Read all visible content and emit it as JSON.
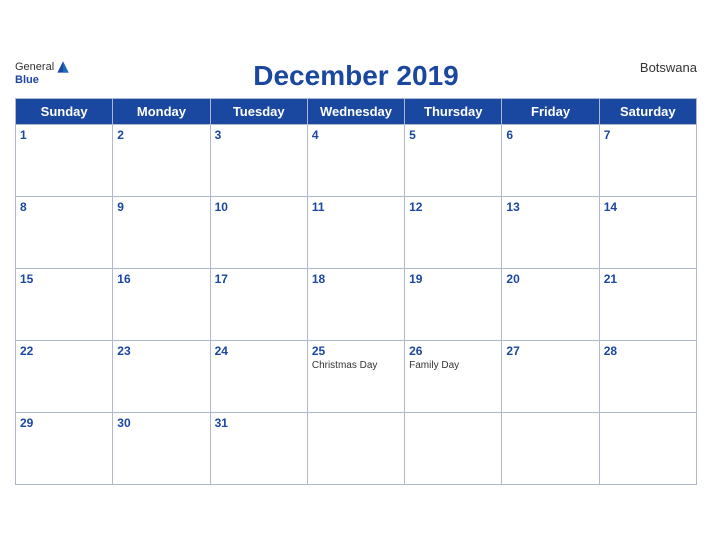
{
  "header": {
    "logo_general": "General",
    "logo_blue": "Blue",
    "title": "December 2019",
    "country": "Botswana"
  },
  "days_of_week": [
    "Sunday",
    "Monday",
    "Tuesday",
    "Wednesday",
    "Thursday",
    "Friday",
    "Saturday"
  ],
  "weeks": [
    [
      {
        "day": "1",
        "holiday": ""
      },
      {
        "day": "2",
        "holiday": ""
      },
      {
        "day": "3",
        "holiday": ""
      },
      {
        "day": "4",
        "holiday": ""
      },
      {
        "day": "5",
        "holiday": ""
      },
      {
        "day": "6",
        "holiday": ""
      },
      {
        "day": "7",
        "holiday": ""
      }
    ],
    [
      {
        "day": "8",
        "holiday": ""
      },
      {
        "day": "9",
        "holiday": ""
      },
      {
        "day": "10",
        "holiday": ""
      },
      {
        "day": "11",
        "holiday": ""
      },
      {
        "day": "12",
        "holiday": ""
      },
      {
        "day": "13",
        "holiday": ""
      },
      {
        "day": "14",
        "holiday": ""
      }
    ],
    [
      {
        "day": "15",
        "holiday": ""
      },
      {
        "day": "16",
        "holiday": ""
      },
      {
        "day": "17",
        "holiday": ""
      },
      {
        "day": "18",
        "holiday": ""
      },
      {
        "day": "19",
        "holiday": ""
      },
      {
        "day": "20",
        "holiday": ""
      },
      {
        "day": "21",
        "holiday": ""
      }
    ],
    [
      {
        "day": "22",
        "holiday": ""
      },
      {
        "day": "23",
        "holiday": ""
      },
      {
        "day": "24",
        "holiday": ""
      },
      {
        "day": "25",
        "holiday": "Christmas Day"
      },
      {
        "day": "26",
        "holiday": "Family Day"
      },
      {
        "day": "27",
        "holiday": ""
      },
      {
        "day": "28",
        "holiday": ""
      }
    ],
    [
      {
        "day": "29",
        "holiday": ""
      },
      {
        "day": "30",
        "holiday": ""
      },
      {
        "day": "31",
        "holiday": ""
      },
      {
        "day": "",
        "holiday": ""
      },
      {
        "day": "",
        "holiday": ""
      },
      {
        "day": "",
        "holiday": ""
      },
      {
        "day": "",
        "holiday": ""
      }
    ]
  ]
}
